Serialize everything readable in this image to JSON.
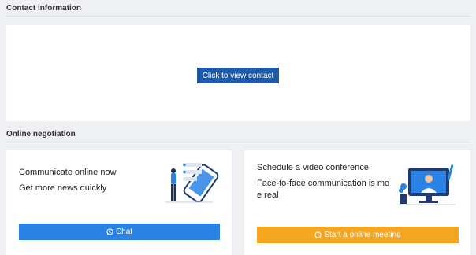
{
  "contact": {
    "title": "Contact information",
    "view_button": "Click to view contact"
  },
  "negotiation": {
    "title": "Online negotiation",
    "chat_card": {
      "line1": "Communicate online now",
      "line2": "Get more news quickly",
      "button": "Chat",
      "button_icon": "whatsapp-icon"
    },
    "meeting_card": {
      "line1": "Schedule a video conference",
      "line2a": "Face-to-face communication is mo",
      "line2b": "e real",
      "button": "Start a online meeting",
      "button_icon": "clock-icon"
    }
  },
  "colors": {
    "primary": "#1f5aa9",
    "chat": "#2b82e5",
    "meeting": "#f4a623"
  }
}
